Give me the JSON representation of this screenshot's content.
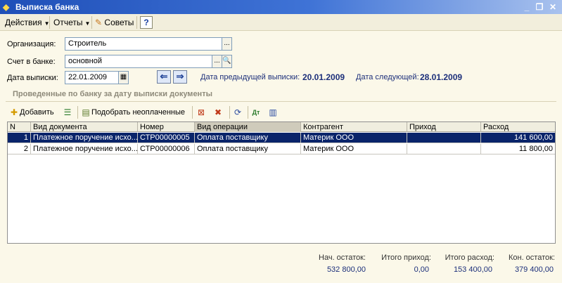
{
  "window": {
    "title": "Выписка банка"
  },
  "menu": {
    "actions": "Действия",
    "reports": "Отчеты",
    "tips": "Советы",
    "help": "?"
  },
  "form": {
    "organization_label": "Организация:",
    "organization_value": "Строитель",
    "account_label": "Счет в банке:",
    "account_value": "основной",
    "date_label": "Дата выписки:",
    "date_value": "22.01.2009",
    "prev_label": "Дата предыдущей выписки:",
    "prev_value": "20.01.2009",
    "next_label": "Дата следующей:",
    "next_value": "28.01.2009"
  },
  "section_title": "Проведенные по банку за дату выписки документы",
  "toolbar": {
    "add": "Добавить",
    "pick_unpaid": "Подобрать неоплаченные"
  },
  "table": {
    "columns": [
      "N",
      "Вид документа",
      "Номер",
      "Вид операции",
      "Контрагент",
      "Приход",
      "Расход"
    ],
    "rows": [
      [
        "1",
        "Платежное поручение исхо...",
        "СТР00000005",
        "Оплата поставщику",
        "Материк ООО",
        "",
        "141 600,00"
      ],
      [
        "2",
        "Платежное поручение исхо...",
        "СТР00000006",
        "Оплата поставщику",
        "Материк ООО",
        "",
        "11 800,00"
      ]
    ]
  },
  "totals": {
    "start_label": "Нач. остаток:",
    "start_value": "532 800,00",
    "income_label": "Итого приход:",
    "income_value": "0,00",
    "expense_label": "Итого расход:",
    "expense_value": "153 400,00",
    "end_label": "Кон. остаток:",
    "end_value": "379 400,00"
  },
  "colors": {
    "title_bar": "#1f4fb8",
    "selection": "#0a246a",
    "info_text": "#1c2f7a",
    "background": "#fbf8e9"
  },
  "icons": [
    "app-icon",
    "minimize-icon",
    "restore-icon",
    "close-icon",
    "tips-icon",
    "help-icon",
    "calendar-icon",
    "search-icon",
    "arrow-left-icon",
    "arrow-right-icon",
    "add-icon",
    "hierarchy-icon",
    "pick-icon",
    "delete-mark-icon",
    "delete-icon",
    "refresh-icon",
    "dt-kt-icon",
    "list-icon"
  ]
}
